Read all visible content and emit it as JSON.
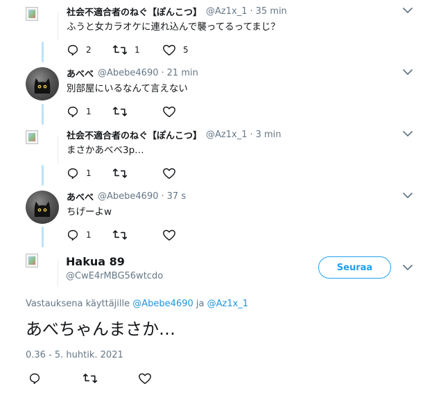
{
  "thread": [
    {
      "name": "社会不適合者のねぐ【ぽんこつ】",
      "handle": "@Az1x_1",
      "sep": "·",
      "time": "35 min",
      "text": "ふうと女カラオケに連れ込んで襲ってるってまじ？",
      "reply_count": "2",
      "retweet_count": "1",
      "like_count": "5",
      "avatar": "broken-image"
    },
    {
      "name": "あべべ",
      "handle": "@Abebe4690",
      "sep": "·",
      "time": "21 min",
      "text": "別部屋にいるなんて言えない",
      "reply_count": "1",
      "retweet_count": "",
      "like_count": "",
      "avatar": "black-cat"
    },
    {
      "name": "社会不適合者のねぐ【ぽんこつ】",
      "handle": "@Az1x_1",
      "sep": "·",
      "time": "3 min",
      "text": "まさかあべべ3p…",
      "reply_count": "1",
      "retweet_count": "",
      "like_count": "",
      "avatar": "broken-image"
    },
    {
      "name": "あべべ",
      "handle": "@Abebe4690",
      "sep": "·",
      "time": "37 s",
      "text": "ちげーよw",
      "reply_count": "1",
      "retweet_count": "",
      "like_count": "",
      "avatar": "black-cat"
    }
  ],
  "main_tweet": {
    "name": "Hakua 89",
    "handle": "@CwE4rMBG56wtcdo",
    "follow_label": "Seuraa",
    "reply_prefix": "Vastauksena käyttäjille",
    "mention_1": "@Abebe4690",
    "reply_and": "ja",
    "mention_2": "@Az1x_1",
    "text": "あべちゃんまさか…",
    "timestamp": "0.36 - 5. huhtik. 2021"
  },
  "colors": {
    "accent": "#1da1f2",
    "thread_line": "#b9e3fb",
    "muted": "#657786",
    "text": "#14171a"
  },
  "icons": [
    "reply-icon",
    "retweet-icon",
    "like-icon",
    "chevron-down-icon",
    "broken-image-icon",
    "black-cat-avatar"
  ]
}
